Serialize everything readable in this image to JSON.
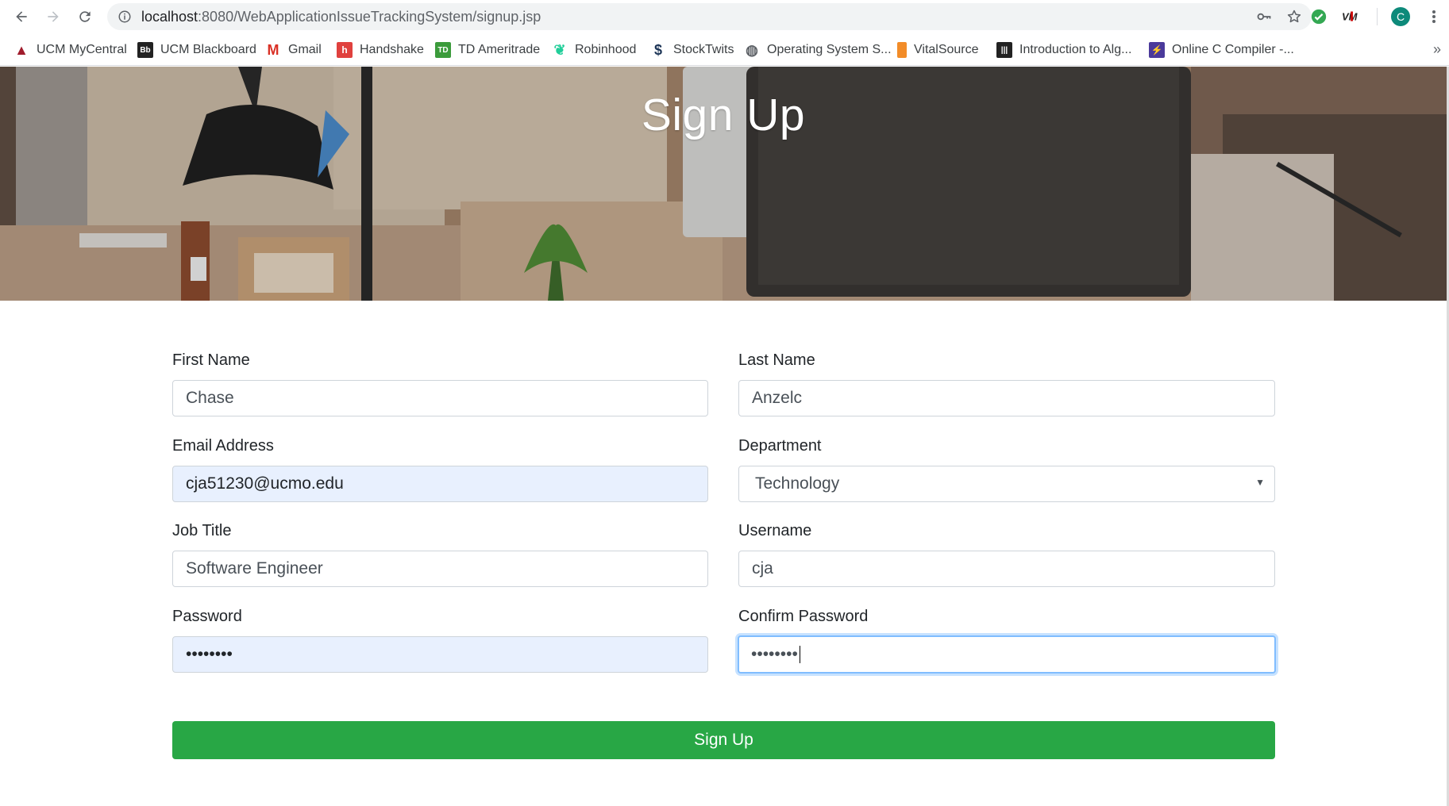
{
  "browser": {
    "url_host": "localhost",
    "url_rest": ":8080/WebApplicationIssueTrackingSystem/signup.jsp",
    "profile_initial": "C",
    "bookmarks": [
      {
        "label": "UCM MyCentral",
        "icon": "ucm-mycentral-icon",
        "color": "#a01c2c"
      },
      {
        "label": "UCM Blackboard",
        "icon": "blackboard-icon",
        "color": "#222222"
      },
      {
        "label": "Gmail",
        "icon": "gmail-icon",
        "color": "#d93025"
      },
      {
        "label": "Handshake",
        "icon": "handshake-icon",
        "color": "#e0413e"
      },
      {
        "label": "TD Ameritrade",
        "icon": "td-ameritrade-icon",
        "color": "#3b9b3b"
      },
      {
        "label": "Robinhood",
        "icon": "robinhood-icon",
        "color": "#21ce99"
      },
      {
        "label": "StockTwits",
        "icon": "stocktwits-icon",
        "color": "#1d3557"
      },
      {
        "label": "Operating System S...",
        "icon": "globe-icon",
        "color": "#5f6368"
      },
      {
        "label": "VitalSource",
        "icon": "vitalsource-icon",
        "color": "#f28c28"
      },
      {
        "label": "Introduction to Alg...",
        "icon": "intro-alg-icon",
        "color": "#222222"
      },
      {
        "label": "Online C Compiler -...",
        "icon": "online-compiler-icon",
        "color": "#4b3a9b"
      }
    ]
  },
  "page": {
    "title": "Sign Up",
    "fields": {
      "first_name": {
        "label": "First Name",
        "value": "Chase"
      },
      "last_name": {
        "label": "Last Name",
        "value": "Anzelc"
      },
      "email": {
        "label": "Email Address",
        "value": "cja51230@ucmo.edu"
      },
      "department": {
        "label": "Department",
        "value": "Technology"
      },
      "job_title": {
        "label": "Job Title",
        "value": "Software Engineer"
      },
      "username": {
        "label": "Username",
        "value": "cja"
      },
      "password": {
        "label": "Password",
        "value": "••••••••"
      },
      "confirm_password": {
        "label": "Confirm Password",
        "value": "••••••••"
      }
    },
    "submit_label": "Sign Up"
  },
  "colors": {
    "accent": "#28a745",
    "focus": "#80bdff",
    "autofill": "#e8f0fe"
  }
}
